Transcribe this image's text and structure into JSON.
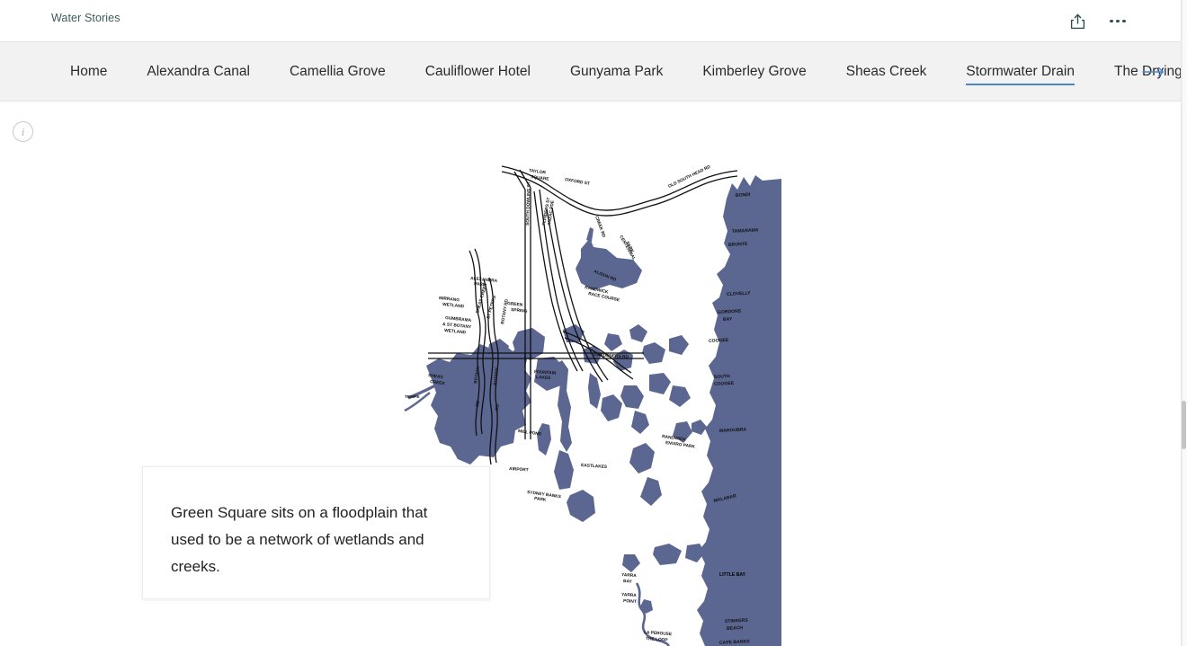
{
  "header": {
    "brand": "Water Stories",
    "share_icon": "share-upload-icon",
    "more_icon": "ellipsis-icon"
  },
  "nav": {
    "items": [
      {
        "label": "Home",
        "active": false
      },
      {
        "label": "Alexandra Canal",
        "active": false
      },
      {
        "label": "Camellia Grove",
        "active": false
      },
      {
        "label": "Cauliflower Hotel",
        "active": false
      },
      {
        "label": "Gunyama Park",
        "active": false
      },
      {
        "label": "Kimberley Grove",
        "active": false
      },
      {
        "label": "Sheas Creek",
        "active": false
      },
      {
        "label": "Stormwater Drain",
        "active": true
      },
      {
        "label": "The Drying Green",
        "active": false
      }
    ],
    "next_arrow_icon": "arrow-right-icon",
    "accent_color": "#4a86c8",
    "background_color": "#f2f2f2"
  },
  "content": {
    "info_badge": "i",
    "card": {
      "text": "Green Square sits on a floodplain that used to be a network of wetlands and creeks."
    },
    "map": {
      "alt": "Hand-drawn historical map of Green Square wetlands and creeks, Sydney",
      "water_color": "#5b6691",
      "land_color": "#ffffff",
      "ink_color": "#111111",
      "labels": [
        "TAYLOR SQUARE",
        "OXFORD ST",
        "OLD SOUTH HEAD RD",
        "CENTENNIAL PARK",
        "SOUTH DOWLING ST",
        "FLINDERS ST",
        "ANZAC PDE",
        "BONDI",
        "TAMARAMA",
        "BRONTE",
        "CLOVELLY",
        "GORDONS BAY",
        "COOGEE",
        "SOUTH COOGEE",
        "MAROUBRA",
        "MALABAR",
        "LITTLE BAY",
        "YARRA BAY",
        "YARRA POINT",
        "LA PEROUSE THE LOOP",
        "STINKERS BEACH",
        "CAPE BANKS",
        "ALEXANDRA PARK",
        "MIRRANG WETLAND",
        "GUMBRAMA & ST BOTANY WETLAND",
        "GREEN SPRING",
        "SHEAS CREEK",
        "TEMPE",
        "BOTANY RD",
        "GARDENERS RD",
        "FOUNTAIN LAKES",
        "MILL POND",
        "EASTLAKES",
        "SYDNEY PARK",
        "RANDWICK RACE COURSE",
        "BOTANY RD",
        "ALISON RD",
        "AIRPORT",
        "OLD ROAD"
      ]
    }
  },
  "scrollbar": {
    "thumb_position": "446",
    "thumb_height": "54"
  }
}
